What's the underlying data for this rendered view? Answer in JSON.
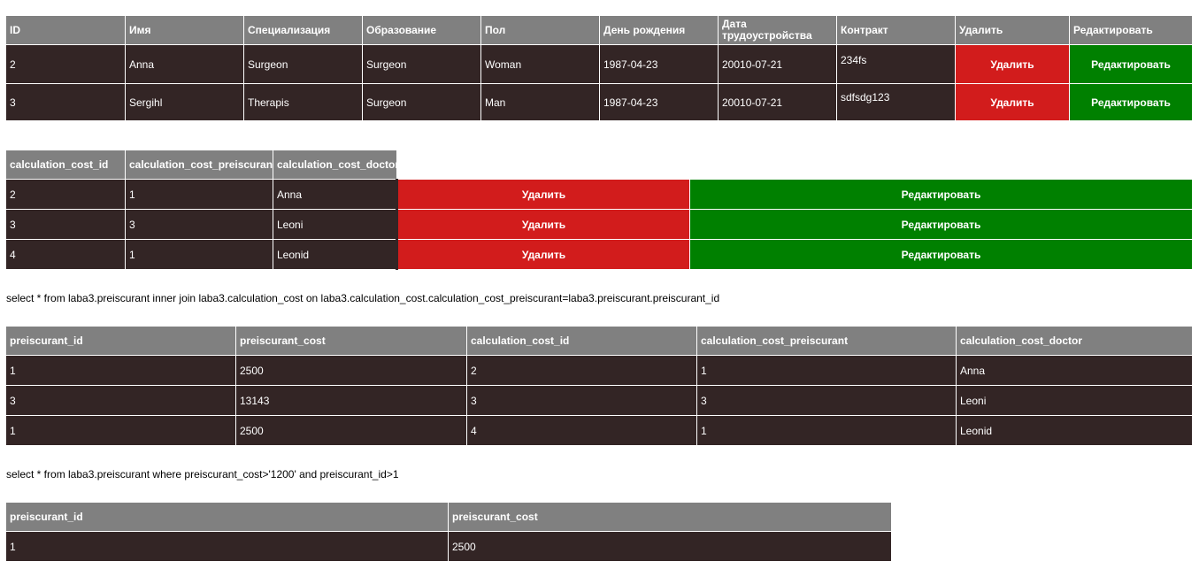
{
  "doctors_table": {
    "headers": [
      "ID",
      "Имя",
      "Специализация",
      "Образование",
      "Пол",
      "День рождения",
      "Дата трудоустройства",
      "Контракт",
      "Удалить",
      "Редактировать"
    ],
    "rows": [
      {
        "id": "2",
        "name": "Anna",
        "specialization": "Surgeon",
        "education": "Surgeon",
        "gender": "Woman",
        "birthday": "1987-04-23",
        "hire_date": "20010-07-21",
        "contract": "234fs",
        "delete_label": "Удалить",
        "edit_label": "Редактировать"
      },
      {
        "id": "3",
        "name": "Sergihl",
        "specialization": "Therapis",
        "education": "Surgeon",
        "gender": "Man",
        "birthday": "1987-04-23",
        "hire_date": "20010-07-21",
        "contract": "sdfsdg123",
        "delete_label": "Удалить",
        "edit_label": "Редактировать"
      }
    ]
  },
  "calc_cost_table": {
    "headers": [
      "calculation_cost_id",
      "calculation_cost_preiscurant",
      "calculation_cost_doctor"
    ],
    "rows": [
      {
        "id": "2",
        "preiscurant": "1",
        "doctor": "Anna",
        "delete_label": "Удалить",
        "edit_label": "Редактировать"
      },
      {
        "id": "3",
        "preiscurant": "3",
        "doctor": "Leoni",
        "delete_label": "Удалить",
        "edit_label": "Редактировать"
      },
      {
        "id": "4",
        "preiscurant": "1",
        "doctor": "Leonid",
        "delete_label": "Удалить",
        "edit_label": "Редактировать"
      }
    ]
  },
  "query1": {
    "sql": "select * from laba3.preiscurant inner join laba3.calculation_cost on laba3.calculation_cost.calculation_cost_preiscurant=laba3.preiscurant.preiscurant_id",
    "headers": [
      "preiscurant_id",
      "preiscurant_cost",
      "calculation_cost_id",
      "calculation_cost_preiscurant",
      "calculation_cost_doctor"
    ],
    "rows": [
      [
        "1",
        "2500",
        "2",
        "1",
        "Anna"
      ],
      [
        "3",
        "13143",
        "3",
        "3",
        "Leoni"
      ],
      [
        "1",
        "2500",
        "4",
        "1",
        "Leonid"
      ]
    ]
  },
  "query2": {
    "sql": "select * from laba3.preiscurant where preiscurant_cost>'1200' and preiscurant_id>1",
    "headers": [
      "preiscurant_id",
      "preiscurant_cost"
    ],
    "rows": [
      [
        "1",
        "2500"
      ]
    ]
  },
  "colors": {
    "header_bg": "#808080",
    "row_bg": "#332525",
    "delete_bg": "#d21c1c",
    "edit_bg": "#008000"
  }
}
